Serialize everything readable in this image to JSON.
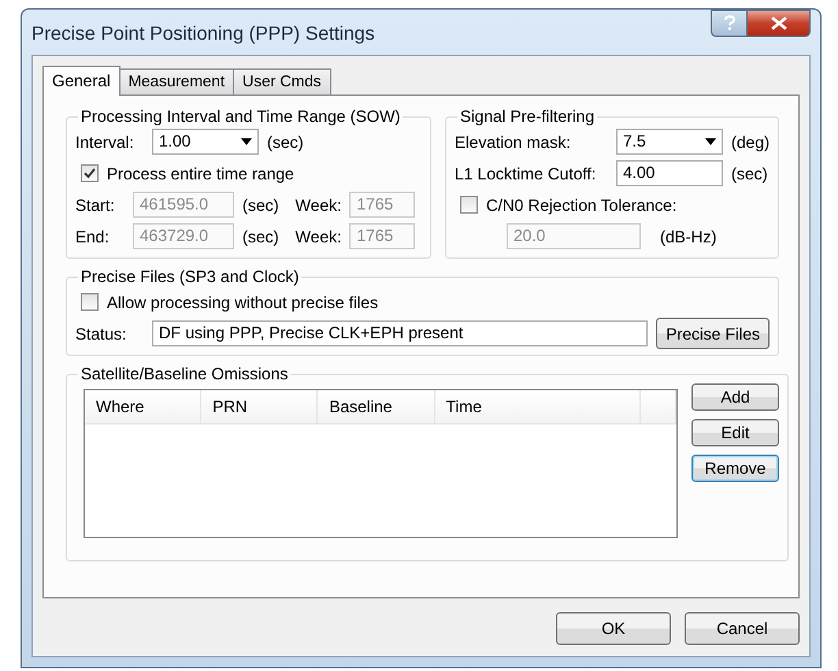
{
  "window": {
    "title": "Precise Point Positioning (PPP) Settings"
  },
  "tabs": [
    {
      "label": "General",
      "selected": true
    },
    {
      "label": "Measurement",
      "selected": false
    },
    {
      "label": "User Cmds",
      "selected": false
    }
  ],
  "processing": {
    "title": "Processing Interval and Time Range (SOW)",
    "interval": {
      "label": "Interval:",
      "value": "1.00",
      "unit": "(sec)"
    },
    "entire_range": {
      "label": "Process entire time range",
      "checked": true
    },
    "ranges": [
      {
        "label": "Start:",
        "value": "461595.0",
        "unit": "(sec)",
        "week_label": "Week:",
        "week": "1765",
        "disabled": true
      },
      {
        "label": "End:",
        "value": "463729.0",
        "unit": "(sec)",
        "week_label": "Week:",
        "week": "1765",
        "disabled": true
      }
    ]
  },
  "signal": {
    "title": "Signal Pre-filtering",
    "elevation": {
      "label": "Elevation mask:",
      "value": "7.5",
      "unit": "(deg)"
    },
    "locktime": {
      "label": "L1 Locktime Cutoff:",
      "value": "4.00",
      "unit": "(sec)"
    },
    "cn0": {
      "label": "C/N0 Rejection Tolerance:",
      "checked": false,
      "value": "20.0",
      "unit": "(dB-Hz)",
      "disabled": true
    }
  },
  "precise": {
    "title": "Precise Files (SP3 and Clock)",
    "allow": {
      "label": "Allow processing without precise files",
      "checked": false
    },
    "status_label": "Status:",
    "status": "DF using PPP, Precise CLK+EPH present",
    "button": "Precise Files"
  },
  "omissions": {
    "title": "Satellite/Baseline Omissions",
    "columns": [
      "Where",
      "PRN",
      "Baseline",
      "Time"
    ],
    "buttons": [
      {
        "label": "Add",
        "focused": false
      },
      {
        "label": "Edit",
        "focused": false
      },
      {
        "label": "Remove",
        "focused": true
      }
    ]
  },
  "footer": {
    "buttons": [
      "OK",
      "Cancel"
    ]
  }
}
